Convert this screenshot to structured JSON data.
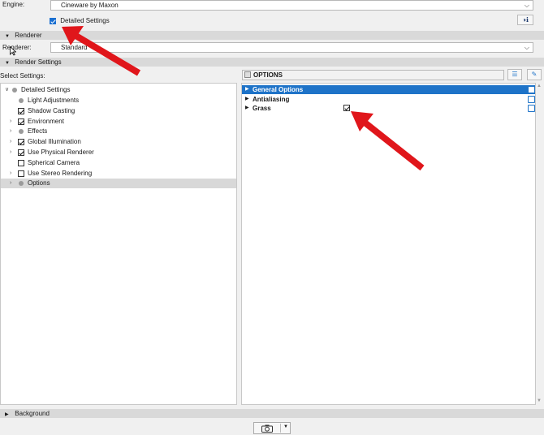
{
  "engine": {
    "label": "Engine:",
    "value": "Cineware by Maxon",
    "detailed_label": "Detailed Settings",
    "detailed_checked": true
  },
  "renderer_section": {
    "title": "Renderer",
    "label": "Renderer:",
    "value": "Standard"
  },
  "render_settings_section": {
    "title": "Render Settings"
  },
  "select_settings": {
    "label": "Select Settings:",
    "options_title": "OPTIONS"
  },
  "tree": {
    "root": "Detailed Settings",
    "items": [
      {
        "label": "Light Adjustments",
        "kind": "dot",
        "expandable": false,
        "checked": false
      },
      {
        "label": "Shadow Casting",
        "kind": "checkbox",
        "expandable": false,
        "checked": true
      },
      {
        "label": "Environment",
        "kind": "checkbox",
        "expandable": true,
        "checked": true
      },
      {
        "label": "Effects",
        "kind": "dot",
        "expandable": true,
        "checked": false
      },
      {
        "label": "Global Illumination",
        "kind": "checkbox",
        "expandable": true,
        "checked": true
      },
      {
        "label": "Use Physical Renderer",
        "kind": "checkbox",
        "expandable": true,
        "checked": true
      },
      {
        "label": "Spherical Camera",
        "kind": "checkbox",
        "expandable": false,
        "checked": false
      },
      {
        "label": "Use Stereo Rendering",
        "kind": "checkbox",
        "expandable": true,
        "checked": false
      },
      {
        "label": "Options",
        "kind": "dot",
        "expandable": true,
        "checked": false,
        "selected": true
      }
    ]
  },
  "options": {
    "rows": [
      {
        "label": "General Options",
        "selected": true
      },
      {
        "label": "Antialiasing",
        "selected": false
      },
      {
        "label": "Grass",
        "selected": false,
        "checkbox": true,
        "checked": true
      }
    ]
  },
  "background_section": {
    "title": "Background"
  },
  "colors": {
    "accent": "#1e73c8",
    "arrow": "#e0161b"
  },
  "icons": {
    "section_expanded": "triangle-down-icon",
    "section_collapsed": "triangle-right-icon",
    "camera": "camera-icon"
  }
}
